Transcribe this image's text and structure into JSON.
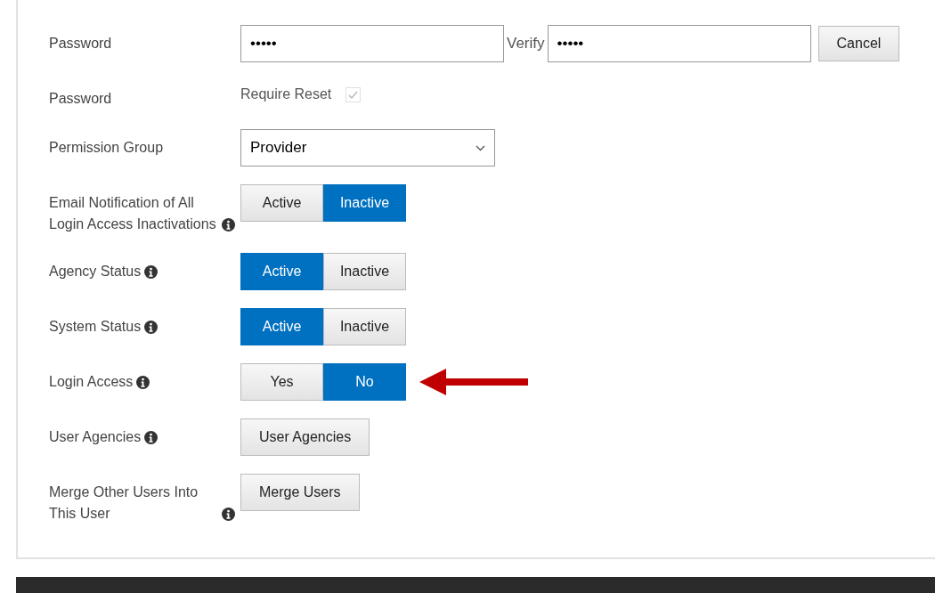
{
  "form": {
    "rows": [
      {
        "kind": "password",
        "label": "Password",
        "info": false,
        "value": "•••••",
        "verify_label": "Verify",
        "verify_value": "•••••",
        "cancel": "Cancel"
      },
      {
        "kind": "checkbox",
        "label": "Password",
        "info": false,
        "text": "Require Reset",
        "checked": true,
        "disabled": true
      },
      {
        "kind": "select",
        "label": "Permission Group",
        "info": false,
        "value": "Provider"
      },
      {
        "kind": "toggle",
        "label": "Email Notification of All Login Access Inactivations",
        "info": true,
        "arrow": false,
        "options": [
          {
            "label": "Active",
            "selected": false
          },
          {
            "label": "Inactive",
            "selected": true
          }
        ]
      },
      {
        "kind": "toggle",
        "label": "Agency Status",
        "info": true,
        "arrow": false,
        "options": [
          {
            "label": "Active",
            "selected": true
          },
          {
            "label": "Inactive",
            "selected": false
          }
        ]
      },
      {
        "kind": "toggle",
        "label": "System Status",
        "info": true,
        "arrow": false,
        "options": [
          {
            "label": "Active",
            "selected": true
          },
          {
            "label": "Inactive",
            "selected": false
          }
        ]
      },
      {
        "kind": "toggle",
        "label": "Login Access",
        "info": true,
        "arrow": true,
        "options": [
          {
            "label": "Yes",
            "selected": false
          },
          {
            "label": "No",
            "selected": true
          }
        ]
      },
      {
        "kind": "button",
        "label": "User Agencies",
        "info": true,
        "button": "User Agencies"
      },
      {
        "kind": "button",
        "label": "Merge Other Users Into This User",
        "info": true,
        "button": "Merge Users"
      }
    ]
  }
}
